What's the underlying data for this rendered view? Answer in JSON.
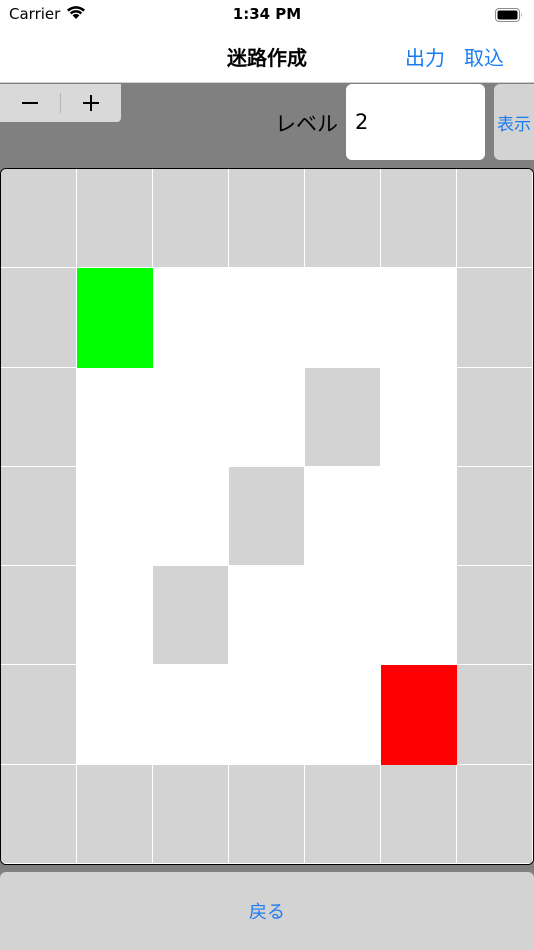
{
  "status_bar": {
    "carrier": "Carrier",
    "time": "1:34 PM"
  },
  "nav": {
    "title": "迷路作成",
    "output_label": "出力",
    "import_label": "取込"
  },
  "controls": {
    "minus_label": "−",
    "plus_label": "+",
    "level_label": "レベル",
    "level_value": "2",
    "show_label": "表示"
  },
  "maze": {
    "cols": 7,
    "rows": 7,
    "legend": {
      "W": "wall",
      "P": "path",
      "S": "start",
      "G": "goal"
    },
    "cells": [
      "WWWWWWW",
      "WSPPPPW",
      "WPPPWPW",
      "WPPWPPW",
      "WPWPPPW",
      "WPPPPGW",
      "WWWWWWW"
    ],
    "colors": {
      "wall": "#d3d3d3",
      "path": "#ffffff",
      "start": "#00ff00",
      "goal": "#ff0000",
      "grid_line": "#ffffff"
    }
  },
  "footer": {
    "back_label": "戻る"
  },
  "colors": {
    "accent": "#1a7cf5",
    "background": "#808080"
  }
}
